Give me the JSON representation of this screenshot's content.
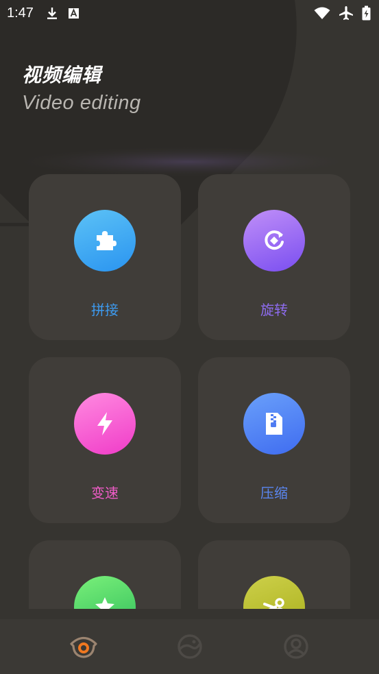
{
  "status_bar": {
    "time": "1:47"
  },
  "header": {
    "title_cn": "视频编辑",
    "title_en": "Video editing"
  },
  "tools": [
    {
      "label": "拼接",
      "icon": "puzzle-icon",
      "label_color": "#3d9bf0",
      "gradient": [
        "#5cc2f6",
        "#2a94f0"
      ]
    },
    {
      "label": "旋转",
      "icon": "rotate-icon",
      "label_color": "#8e6cf0",
      "gradient": [
        "#c08ff8",
        "#7a4ef0"
      ]
    },
    {
      "label": "变速",
      "icon": "lightning-icon",
      "label_color": "#f05cc8",
      "gradient": [
        "#ff8ae0",
        "#f03cc8"
      ]
    },
    {
      "label": "压缩",
      "icon": "zip-file-icon",
      "label_color": "#5a86f0",
      "gradient": [
        "#6aa0fa",
        "#3f6cf0"
      ]
    },
    {
      "label": "",
      "icon": "star-icon",
      "label_color": "#3ec86a",
      "gradient": [
        "#7af07a",
        "#2ebc5a"
      ]
    },
    {
      "label": "",
      "icon": "scissors-icon",
      "label_color": "#b8bc2a",
      "gradient": [
        "#cdd04a",
        "#a8ae1a"
      ]
    }
  ],
  "nav": {
    "items": [
      {
        "icon": "home-eye-icon",
        "active": true
      },
      {
        "icon": "discover-icon",
        "active": false
      },
      {
        "icon": "profile-icon",
        "active": false
      }
    ],
    "active_color": "#f07820",
    "inactive_color": "#4d4a46"
  }
}
